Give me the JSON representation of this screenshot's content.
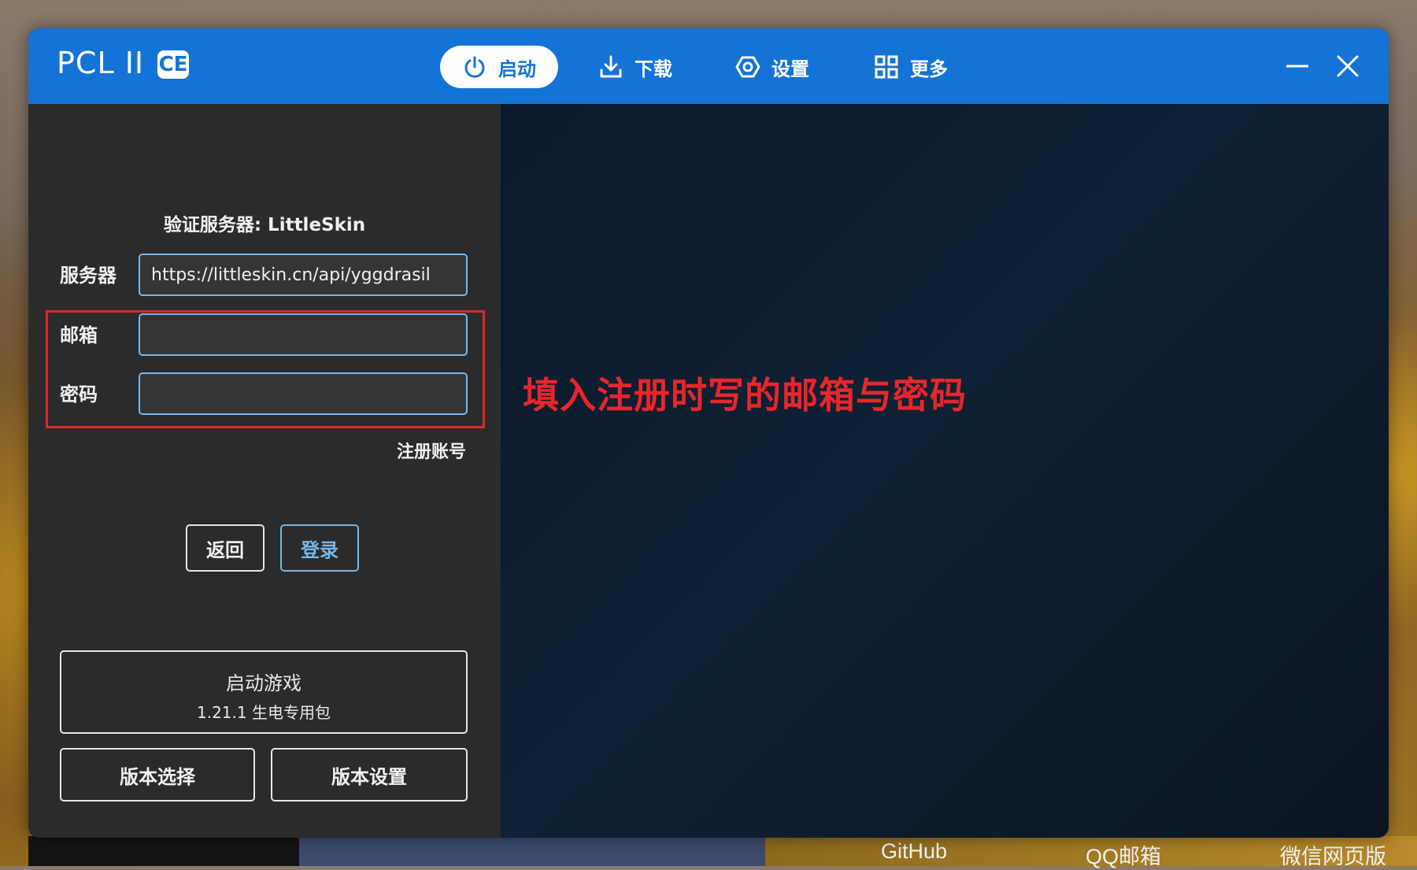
{
  "app": {
    "logo": "PCL II",
    "badge": "CE"
  },
  "nav": [
    {
      "label": "启动",
      "icon": "power-icon",
      "active": true
    },
    {
      "label": "下载",
      "icon": "download-icon",
      "active": false
    },
    {
      "label": "设置",
      "icon": "settings-icon",
      "active": false
    },
    {
      "label": "更多",
      "icon": "grid-icon",
      "active": false
    }
  ],
  "window_controls": {
    "minimize": "minimize-icon",
    "close": "close-icon"
  },
  "login": {
    "auth_server_title": "验证服务器: LittleSkin",
    "server_label": "服务器",
    "server_value": "https://littleskin.cn/api/yggdrasil",
    "email_label": "邮箱",
    "email_value": "",
    "password_label": "密码",
    "password_value": "",
    "register_link": "注册账号",
    "back_button": "返回",
    "login_button": "登录"
  },
  "launch": {
    "title": "启动游戏",
    "version": "1.21.1 生电专用包",
    "version_select": "版本选择",
    "version_settings": "版本设置"
  },
  "annotation": "填入注册时写的邮箱与密码",
  "taskbar": {
    "links": [
      "GitHub",
      "QQ邮箱",
      "微信网页版"
    ]
  },
  "colors": {
    "accent": "#1473d6",
    "input_border": "#74b8ec",
    "highlight": "#e0262a",
    "panel": "#2b2b2b"
  }
}
